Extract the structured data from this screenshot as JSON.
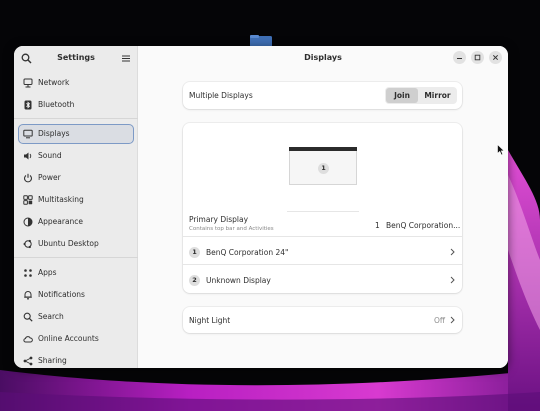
{
  "colors": {
    "accent_outline": "#7d9ac6",
    "sidebar_bg": "#ebebeb",
    "content_bg": "#fafafa",
    "wallpaper_magenta": "#c11ec4"
  },
  "sidebar": {
    "title": "Settings",
    "search_icon": "search-icon",
    "menu_icon": "hamburger-menu-icon",
    "items": [
      {
        "label": "Network",
        "icon": "network-icon"
      },
      {
        "label": "Bluetooth",
        "icon": "bluetooth-icon"
      },
      {
        "label": "Displays",
        "icon": "display-icon",
        "selected": true
      },
      {
        "label": "Sound",
        "icon": "sound-icon"
      },
      {
        "label": "Power",
        "icon": "power-icon"
      },
      {
        "label": "Multitasking",
        "icon": "multitasking-icon"
      },
      {
        "label": "Appearance",
        "icon": "appearance-icon"
      },
      {
        "label": "Ubuntu Desktop",
        "icon": "ubuntu-desktop-icon"
      },
      {
        "label": "Apps",
        "icon": "apps-icon"
      },
      {
        "label": "Notifications",
        "icon": "notifications-icon"
      },
      {
        "label": "Search",
        "icon": "search-icon"
      },
      {
        "label": "Online Accounts",
        "icon": "online-accounts-icon"
      },
      {
        "label": "Sharing",
        "icon": "sharing-icon"
      }
    ]
  },
  "content": {
    "title": "Displays",
    "multiple_displays": {
      "label": "Multiple Displays",
      "options": [
        "Join",
        "Mirror"
      ],
      "selected": "Join"
    },
    "arrangement": {
      "monitor_number": "1"
    },
    "primary_display": {
      "label": "Primary Display",
      "subtitle": "Contains top bar and Activities",
      "value_number": "1",
      "value": "BenQ Corporation..."
    },
    "displays": [
      {
        "number": "1",
        "name": "BenQ Corporation 24\""
      },
      {
        "number": "2",
        "name": "Unknown Display"
      }
    ],
    "night_light": {
      "label": "Night Light",
      "value": "Off"
    }
  }
}
